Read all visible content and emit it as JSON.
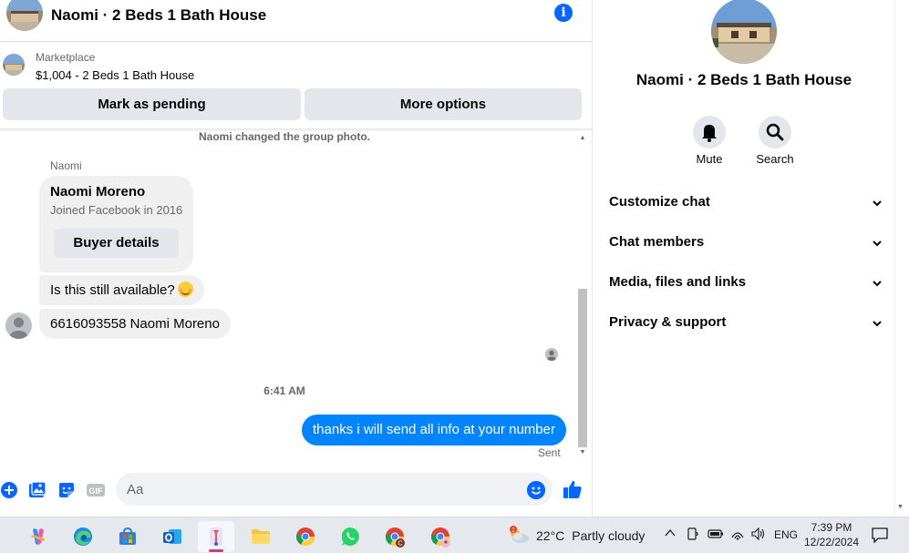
{
  "header": {
    "title": "Naomi · 2 Beds 1 Bath House",
    "info_icon": "i"
  },
  "listing": {
    "label": "Marketplace",
    "description": "$1,004 - 2 Beds 1 Bath House",
    "mark_pending_label": "Mark as pending",
    "more_options_label": "More options"
  },
  "messages": {
    "system_note": "Naomi changed the group photo.",
    "sender_name": "Naomi",
    "buyer_card": {
      "name": "Naomi Moreno",
      "joined": "Joined Facebook in 2016",
      "button_label": "Buyer details"
    },
    "incoming": [
      {
        "text": "Is this still available?"
      },
      {
        "text": "6616093558 Naomi Moreno"
      }
    ],
    "time_separator": "6:41 AM",
    "outgoing": {
      "text": "thanks i will send all info at your number",
      "status": "Sent"
    }
  },
  "composer": {
    "placeholder": "Aa",
    "value": "",
    "gif_label": "GIF"
  },
  "sidebar": {
    "title": "Naomi · 2 Beds 1 Bath House",
    "actions": [
      {
        "label": "Mute",
        "icon": "bell-icon"
      },
      {
        "label": "Search",
        "icon": "search-icon"
      }
    ],
    "sections": [
      {
        "label": "Customize chat"
      },
      {
        "label": "Chat members"
      },
      {
        "label": "Media, files and links"
      },
      {
        "label": "Privacy & support"
      }
    ]
  },
  "taskbar": {
    "weather": {
      "temperature": "22°C",
      "condition": "Partly cloudy"
    },
    "language": "ENG",
    "time": "7:39 PM",
    "date": "12/22/2024",
    "badge_count": "1",
    "profile_initial": "C"
  },
  "colors": {
    "accent": "#0866ff",
    "outgoing_bubble": "#0084ff",
    "bubble_gray": "#f0f0f0",
    "button_gray": "#e4e6eb"
  }
}
